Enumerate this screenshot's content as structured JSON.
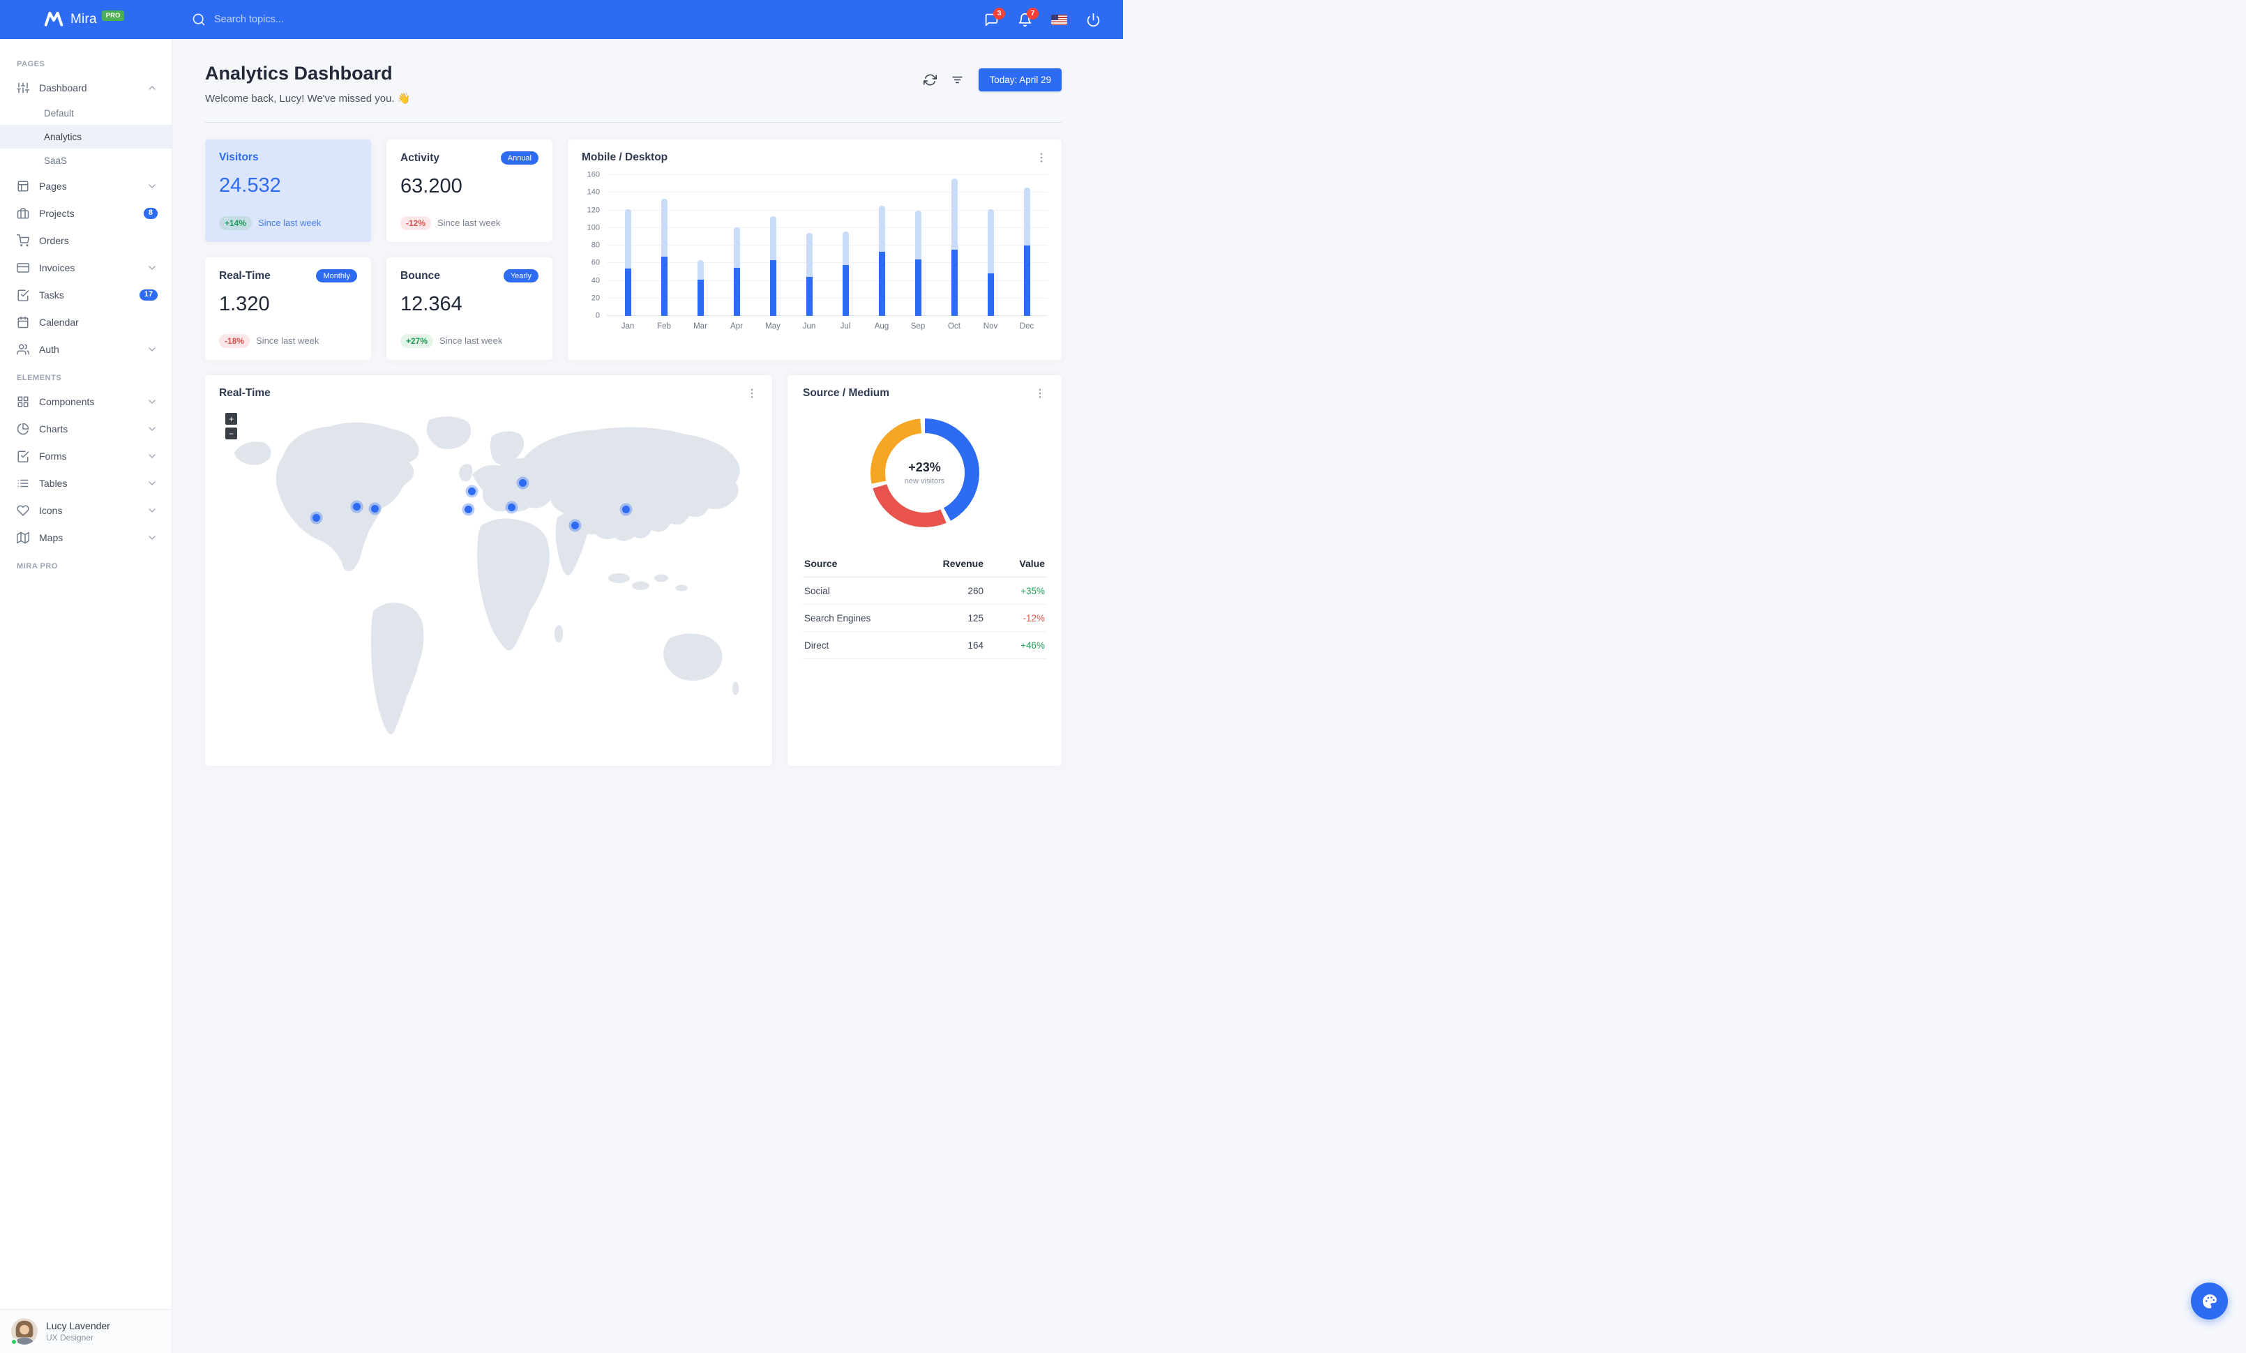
{
  "theme": {
    "primary": "#2d6bf2",
    "body_bg": "#f5f7fb",
    "highlight_card_bg": "#dbe6fc",
    "success_green": "#23a45b",
    "danger_red": "#e0544e",
    "navbar_badge_red": "#f44336",
    "pro_badge_green": "#4caf50"
  },
  "navbar": {
    "brand": "Mira",
    "brand_badge": "PRO",
    "search_placeholder": "Search topics...",
    "messages_count": "3",
    "notifications_count": "7"
  },
  "sidebar": {
    "section_pages": "PAGES",
    "section_elements": "ELEMENTS",
    "section_pro": "MIRA PRO",
    "pages_items": [
      {
        "label": "Dashboard",
        "icon": "sliders-icon",
        "chevron": "up",
        "children": [
          "Default",
          "Analytics",
          "SaaS"
        ],
        "active_child": "Analytics"
      },
      {
        "label": "Pages",
        "icon": "layout-icon",
        "chevron": "down"
      },
      {
        "label": "Projects",
        "icon": "briefcase-icon",
        "badge": "8"
      },
      {
        "label": "Orders",
        "icon": "shopping-cart-icon"
      },
      {
        "label": "Invoices",
        "icon": "credit-card-icon",
        "chevron": "down"
      },
      {
        "label": "Tasks",
        "icon": "check-square-icon",
        "badge": "17"
      },
      {
        "label": "Calendar",
        "icon": "calendar-icon"
      },
      {
        "label": "Auth",
        "icon": "users-icon",
        "chevron": "down"
      }
    ],
    "elements_items": [
      {
        "label": "Components",
        "icon": "grid-icon",
        "chevron": "down"
      },
      {
        "label": "Charts",
        "icon": "pie-chart-icon",
        "chevron": "down"
      },
      {
        "label": "Forms",
        "icon": "check-square-icon",
        "chevron": "down"
      },
      {
        "label": "Tables",
        "icon": "list-icon",
        "chevron": "down"
      },
      {
        "label": "Icons",
        "icon": "heart-icon",
        "chevron": "down"
      },
      {
        "label": "Maps",
        "icon": "map-icon",
        "chevron": "down"
      }
    ],
    "user": {
      "name": "Lucy Lavender",
      "role": "UX Designer"
    }
  },
  "header": {
    "title": "Analytics Dashboard",
    "subtitle": "Welcome back, Lucy! We've missed you. 👋",
    "today_button": "Today: April 29"
  },
  "stats": {
    "cards": [
      {
        "title": "Visitors",
        "value": "24.532",
        "delta": "+14%",
        "delta_type": "positive",
        "note": "Since last week",
        "highlight": true
      },
      {
        "title": "Activity",
        "badge": "Annual",
        "value": "63.200",
        "delta": "-12%",
        "delta_type": "negative",
        "note": "Since last week"
      },
      {
        "title": "Real-Time",
        "badge": "Monthly",
        "value": "1.320",
        "delta": "-18%",
        "delta_type": "negative",
        "note": "Since last week"
      },
      {
        "title": "Bounce",
        "badge": "Yearly",
        "value": "12.364",
        "delta": "+27%",
        "delta_type": "positive",
        "note": "Since last week"
      }
    ]
  },
  "chart_data": [
    {
      "type": "bar",
      "stacked": true,
      "title": "Mobile / Desktop",
      "categories": [
        "Jan",
        "Feb",
        "Mar",
        "Apr",
        "May",
        "Jun",
        "Jul",
        "Aug",
        "Sep",
        "Oct",
        "Nov",
        "Dec"
      ],
      "series": [
        {
          "name": "Mobile",
          "color": "#2d6bf2",
          "values": [
            54,
            67,
            41,
            55,
            63,
            44,
            58,
            73,
            64,
            75,
            48,
            80
          ]
        },
        {
          "name": "Desktop",
          "color": "#cbdcf9",
          "values": [
            67,
            66,
            22,
            46,
            50,
            50,
            38,
            52,
            56,
            81,
            73,
            66
          ]
        }
      ],
      "ylim": [
        0,
        160
      ],
      "ytick_step": 20,
      "grid": true,
      "legend": "none"
    },
    {
      "type": "pie",
      "title": "Source / Medium",
      "donut": true,
      "center_label": "+23%",
      "center_sublabel": "new visitors",
      "slices": [
        {
          "name": "Direct",
          "color": "#2d6bf2",
          "value": 44
        },
        {
          "name": "Search",
          "color": "#e8544d",
          "value": 28
        },
        {
          "name": "Social",
          "color": "#f5a623",
          "value": 28
        }
      ]
    }
  ],
  "realtime_map": {
    "title": "Real-Time",
    "zoom_in": "+",
    "zoom_out": "−",
    "markers": [
      {
        "left": 18.0,
        "top": 162
      },
      {
        "left": 25.5,
        "top": 146
      },
      {
        "left": 28.8,
        "top": 149
      },
      {
        "left": 46.2,
        "top": 150
      },
      {
        "left": 46.8,
        "top": 124
      },
      {
        "left": 54.2,
        "top": 147
      },
      {
        "left": 56.3,
        "top": 112
      },
      {
        "left": 66.0,
        "top": 173
      },
      {
        "left": 75.4,
        "top": 150
      }
    ]
  },
  "source_medium": {
    "title": "Source / Medium",
    "table": {
      "headers": [
        "Source",
        "Revenue",
        "Value"
      ],
      "rows": [
        {
          "source": "Social",
          "revenue": "260",
          "value": "+35%",
          "value_type": "positive"
        },
        {
          "source": "Search Engines",
          "revenue": "125",
          "value": "-12%",
          "value_type": "negative"
        },
        {
          "source": "Direct",
          "revenue": "164",
          "value": "+46%",
          "value_type": "positive"
        }
      ]
    }
  }
}
